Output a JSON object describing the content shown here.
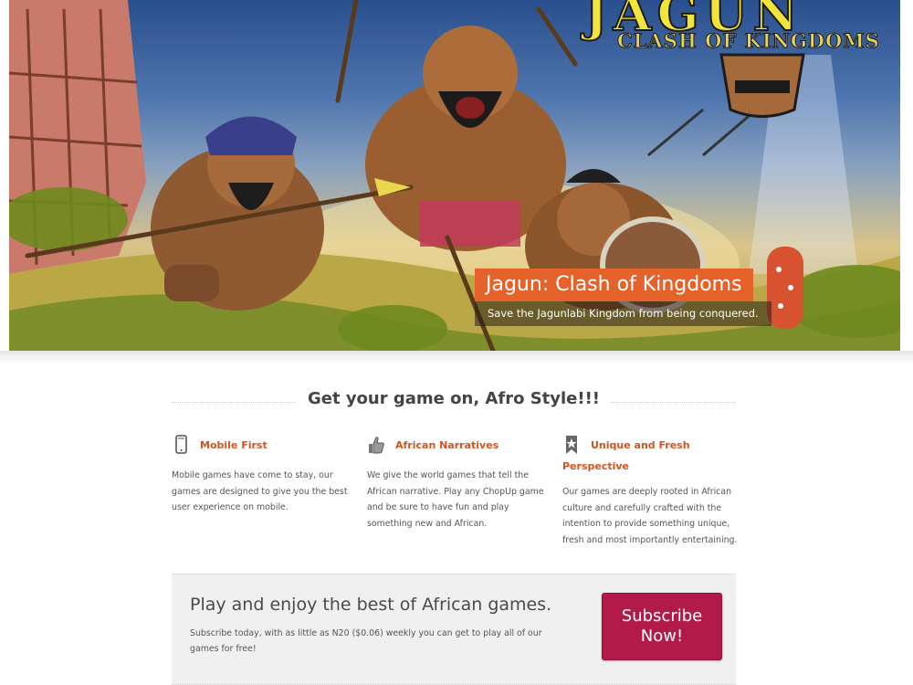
{
  "hero": {
    "logo_title": "JAGUN",
    "logo_subtitle": "CLASH OF KINGDOMS",
    "caption_title": "Jagun: Clash of Kingdoms",
    "caption_subtitle": "Save the Jagunlabi Kingdom from being conquered."
  },
  "section": {
    "headline": "Get your game on, Afro Style!!!"
  },
  "features": [
    {
      "icon": "mobile-phone-icon",
      "title": "Mobile First",
      "text": "Mobile games have come to stay, our games are designed to give you the best user experience on mobile."
    },
    {
      "icon": "thumbs-up-icon",
      "title": "African Narratives",
      "text": "We give the world games that tell the African narrative. Play any ChopUp game and be sure to have fun and play something new and African."
    },
    {
      "icon": "award-ribbon-icon",
      "title": "Unique and Fresh Perspective",
      "text": "Our games are deeply rooted in African culture and carefully crafted with the intention to provide something unique, fresh and most importantly entertaining."
    }
  ],
  "banner": {
    "title": "Play and enjoy the best of African games.",
    "text": "Subscribe today, with as little as N20 ($0.06) weekly you can get to play all of our games for free!",
    "button_label": "Subscribe Now!"
  },
  "colors": {
    "accent": "#d2541e",
    "caption_bg": "#e5622a",
    "button": "#b21a4a"
  }
}
